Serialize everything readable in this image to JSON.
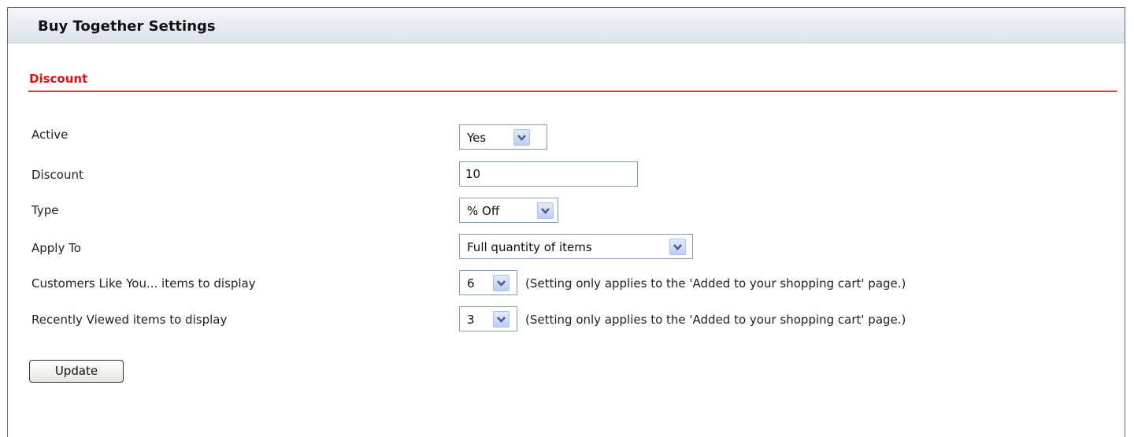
{
  "header": {
    "title": "Buy Together Settings"
  },
  "section": {
    "title": "Discount"
  },
  "fields": {
    "active": {
      "label": "Active",
      "value": "Yes"
    },
    "discount": {
      "label": "Discount",
      "value": "10"
    },
    "type": {
      "label": "Type",
      "value": "% Off"
    },
    "apply_to": {
      "label": "Apply To",
      "value": "Full quantity of items"
    },
    "customers_like_you": {
      "label": "Customers Like You... items to display",
      "value": "6",
      "note": "(Setting only applies to the 'Added to your shopping cart' page.)"
    },
    "recently_viewed": {
      "label": "Recently Viewed items to display",
      "value": "3",
      "note": "(Setting only applies to the 'Added to your shopping cart' page.)"
    }
  },
  "actions": {
    "update_label": "Update"
  },
  "colors": {
    "section_title": "#e01010",
    "section_rule": "#f03030",
    "select_border": "#7f9db9",
    "arrow_fill": "#bccdf3",
    "arrow_glyph": "#4d6185"
  },
  "icons": {
    "dropdown": "chevron-down-icon"
  }
}
